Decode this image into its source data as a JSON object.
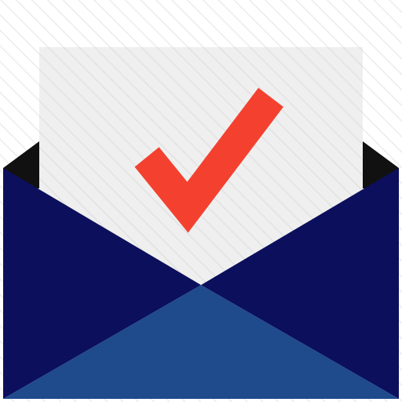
{
  "icon": {
    "name": "envelope-check-icon",
    "colors": {
      "background": "#ffffff",
      "hatch": "#ececec",
      "paper": "#efefef",
      "paper_hatch": "#e2e2e2",
      "check": "#f4412f",
      "envelope_back": "#111111",
      "envelope_side": "#0b0f5c",
      "envelope_front": "#1f4a8c"
    }
  }
}
